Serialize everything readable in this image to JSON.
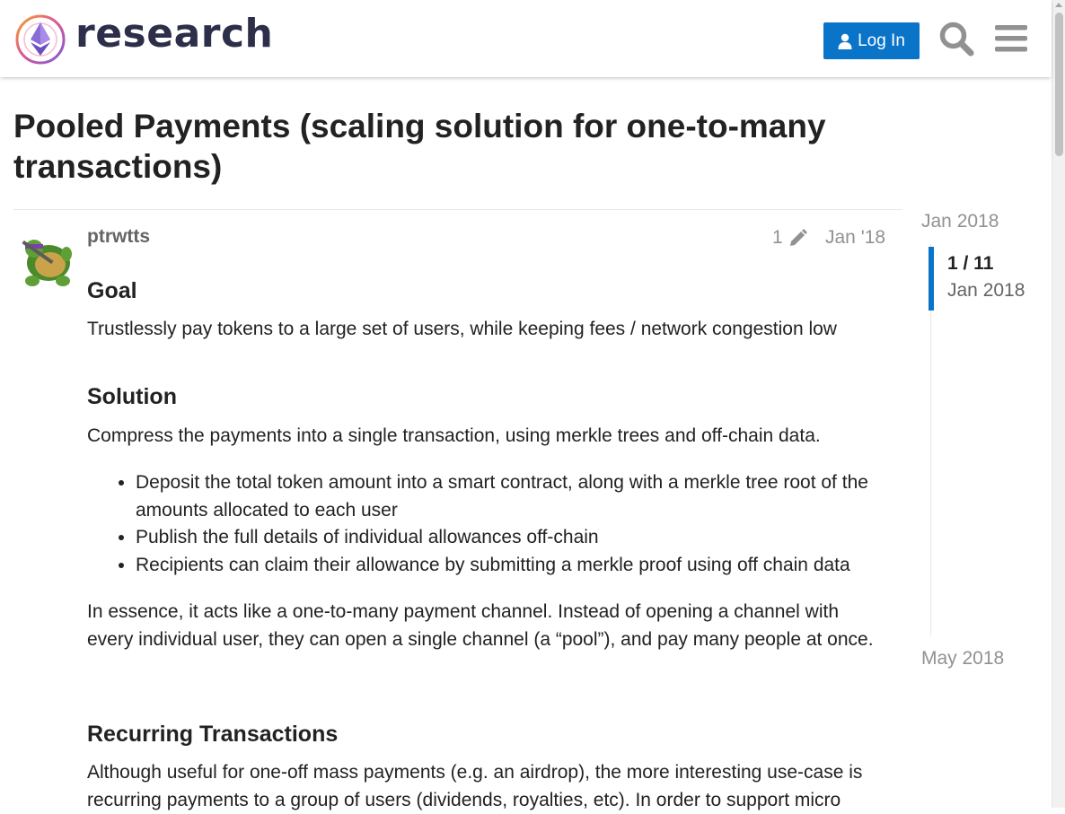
{
  "header": {
    "logo_text": "research",
    "login_label": "Log In"
  },
  "topic": {
    "title": "Pooled Payments (scaling solution for one-to-many transactions)"
  },
  "post": {
    "username": "ptrwtts",
    "edit_count": "1",
    "date": "Jan '18",
    "goal_heading": "Goal",
    "goal_text": "Trustlessly pay tokens to a large set of users, while keeping fees / network congestion low",
    "solution_heading": "Solution",
    "solution_text": "Compress the payments into a single transaction, using merkle trees and off-chain data.",
    "solution_items": [
      "Deposit the total token amount into a smart contract, along with a merkle tree root of the amounts allocated to each user",
      "Publish the full details of individual allowances off-chain",
      "Recipients can claim their allowance by submitting a merkle proof using off chain data"
    ],
    "essence_text": "In essence, it acts like a one-to-many payment channel. Instead of opening a channel with every individual user, they can open a single channel (a “pool”), and pay many people at once.",
    "recurring_heading": "Recurring Transactions",
    "recurring_text": "Although useful for one-off mass payments (e.g. an airdrop), the more interesting use-case is recurring payments to a group of users (dividends, royalties, etc). In order to support micro"
  },
  "timeline": {
    "start_date": "Jan 2018",
    "counter": "1 / 11",
    "handle_date": "Jan 2018",
    "end_date": "May 2018"
  },
  "colors": {
    "accent": "#0a74c9",
    "text": "#222222",
    "muted": "#919191",
    "username": "#646464"
  }
}
